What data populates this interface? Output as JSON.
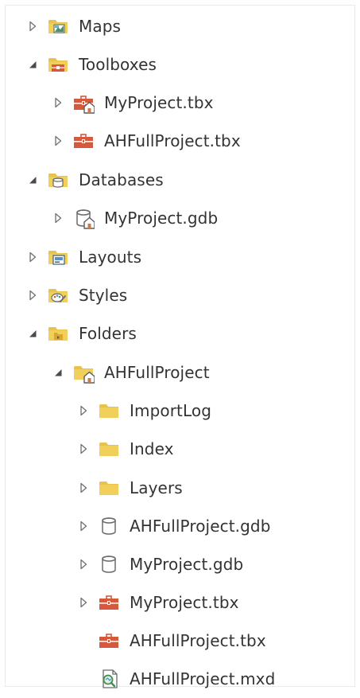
{
  "tree": {
    "maps": {
      "label": "Maps",
      "icon": "map-folder-icon",
      "expanded": false
    },
    "toolboxes": {
      "label": "Toolboxes",
      "icon": "toolbox-folder-icon",
      "expanded": true,
      "children": [
        {
          "label": "MyProject.tbx",
          "icon": "toolbox-home-icon",
          "expanded": false
        },
        {
          "label": "AHFullProject.tbx",
          "icon": "toolbox-icon",
          "expanded": false
        }
      ]
    },
    "databases": {
      "label": "Databases",
      "icon": "database-folder-icon",
      "expanded": true,
      "children": [
        {
          "label": "MyProject.gdb",
          "icon": "geodatabase-home-icon",
          "expanded": false
        }
      ]
    },
    "layouts": {
      "label": "Layouts",
      "icon": "layout-folder-icon",
      "expanded": false
    },
    "styles": {
      "label": "Styles",
      "icon": "style-folder-icon",
      "expanded": false
    },
    "folders": {
      "label": "Folders",
      "icon": "folders-folder-icon",
      "expanded": true,
      "children": [
        {
          "label": "AHFullProject",
          "icon": "home-folder-icon",
          "expanded": true,
          "children": [
            {
              "label": "ImportLog",
              "icon": "folder-icon",
              "expanded": false
            },
            {
              "label": "Index",
              "icon": "folder-icon",
              "expanded": false
            },
            {
              "label": "Layers",
              "icon": "folder-icon",
              "expanded": false
            },
            {
              "label": "AHFullProject.gdb",
              "icon": "geodatabase-icon",
              "expanded": false
            },
            {
              "label": "MyProject.gdb",
              "icon": "geodatabase-icon",
              "expanded": false
            },
            {
              "label": "MyProject.tbx",
              "icon": "toolbox-icon",
              "expanded": false
            },
            {
              "label": "AHFullProject.tbx",
              "icon": "toolbox-icon"
            },
            {
              "label": "AHFullProject.mxd",
              "icon": "map-document-icon"
            }
          ]
        }
      ]
    }
  },
  "colors": {
    "folder": "#e8c24a",
    "folder_dark": "#d9a82a",
    "toolbox": "#d6593c",
    "toggle": "#6f6f6f",
    "database_stroke": "#6b6b6b"
  }
}
